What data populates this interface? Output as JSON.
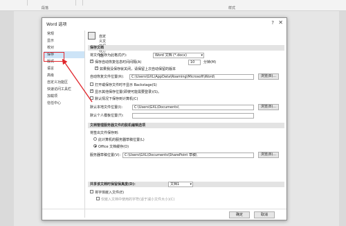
{
  "ribbon": {
    "group1": "段落",
    "group2": "样式"
  },
  "dialog": {
    "title": "Word 选项",
    "help": "?",
    "close": "✕",
    "nav": [
      "常规",
      "显示",
      "校对",
      "保存",
      "版式",
      "语言",
      "高级",
      "自定义功能区",
      "快速访问工具栏",
      "加载项",
      "信任中心"
    ],
    "active_nav": "保存",
    "intro": "自定义文档保存方式。",
    "save_section": {
      "header": "保存文档",
      "format_label": "将文件保存为此格式(F):",
      "format_value": "Word 文档 (*.docx)",
      "autorecover_label": "保存自动恢复信息时间间隔(A)",
      "autorecover_value": "10",
      "minutes": "分钟(M)",
      "keep_last_label": "如果我没保存就关闭，请保留上次自动保留的版本",
      "ar_path_label": "自动恢复文件位置(R):",
      "ar_path_value": "C:\\Users\\GXL\\AppData\\Roaming\\Microsoft\\Word\\",
      "browse": "浏览(B)...",
      "backstage_label": "打开或保存文件时不显示 Backstage(S)",
      "show_locations_label": "显示其他保存位置(即使可能需要登录)(S)。",
      "default_local_label": "默认情况下保存到计算机(C)",
      "default_local_path_label": "默认本地文件位置(I):",
      "default_local_path_value": "C:\\Users\\GXL\\Documents\\",
      "browse2": "浏览(B)...",
      "personal_templates_label": "默认个人模板位置(T):"
    },
    "offline_section": {
      "header": "文档管理服务器文件的脱机编辑选项",
      "save_checked_out_label": "将签出文件保存到:",
      "radio1": "此计算机的服务器草稿位置(L)",
      "radio2": "Office 文档缓存(O)",
      "drafts_label": "服务器草稿位置(V):",
      "drafts_value": "C:\\Users\\GXL\\Documents\\SharePoint 草稿\\",
      "browse3": "浏览(B)..."
    },
    "fidelity_section": {
      "header": "共享该文档时保留保真度(D):",
      "doc_value": "文档1",
      "embed_fonts_label": "将字体嵌入文件(E)",
      "embed_sub_label": "仅嵌入文档中使用的字符(适于减小文件大小)(C)"
    },
    "ok": "确定",
    "cancel": "取消"
  },
  "colors": {
    "highlight_red": "#e0252b",
    "nav_active": "#cde4f7",
    "section_bg": "#e3e3e3"
  }
}
